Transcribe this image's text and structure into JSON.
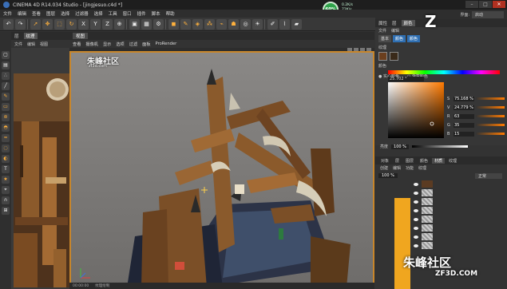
{
  "window": {
    "title": "CINEMA 4D R14.034 Studio - [jingjesuo.c4d *]",
    "minimize": "–",
    "maximize": "□",
    "close": "✕"
  },
  "menubar": [
    "文件",
    "编辑",
    "查看",
    "图层",
    "选择",
    "过滤器",
    "选择",
    "工具",
    "窗口",
    "插件",
    "脚本",
    "帮助"
  ],
  "performance": {
    "badge": "60%",
    "up": "0.2K/s",
    "down": "72K/s"
  },
  "texture_panel": {
    "tabs": [
      "层",
      "纹理"
    ],
    "menu": [
      "文件",
      "编辑",
      "视图"
    ]
  },
  "viewport": {
    "tab": "视图",
    "menu": [
      "查看",
      "摄像机",
      "显示",
      "选项",
      "过滤",
      "面板",
      "ProRender"
    ],
    "watermark_cn": "朱峰社区",
    "watermark_url": "zf3d.com"
  },
  "attributes": {
    "layout_label": "界面:",
    "layout_value": "启动",
    "tabs": [
      "属性",
      "层",
      "颜色"
    ],
    "menu": [
      "文件",
      "编辑"
    ],
    "subtabs": [
      "基本",
      "颜色",
      "颜色"
    ],
    "section_textures": "纹理",
    "section_color": "颜色",
    "color_mode_a": "● 实心颜色",
    "color_mode_b": "○ 渐变颜色",
    "hex": "25.702 °",
    "hsv": [
      {
        "k": "H",
        "v": "25.702 °"
      },
      {
        "k": "S",
        "v": "75.168 %"
      },
      {
        "k": "V",
        "v": "24.779 %"
      },
      {
        "k": "R",
        "v": "63"
      },
      {
        "k": "G",
        "v": "35"
      },
      {
        "k": "B",
        "v": "15"
      }
    ],
    "brightness_label": "亮度",
    "brightness_value": "100 %"
  },
  "layers": {
    "tabs": [
      "对象",
      "层",
      "图层",
      "颜色",
      "材质",
      "纹理"
    ],
    "menu": [
      "创建",
      "编辑",
      "功能",
      "纹理"
    ],
    "opacity": "100 %",
    "blend": "正常",
    "rows": 8
  },
  "watermark_br": {
    "cn": "朱峰社区",
    "url": "ZF3D.COM",
    "logo": "Z"
  },
  "statusbar": [
    "00:00:00",
    "纹理绘制"
  ],
  "colors": {
    "accent": "#c8862b",
    "highlight": "#2f6fb2",
    "warn": "#f0a61f"
  }
}
